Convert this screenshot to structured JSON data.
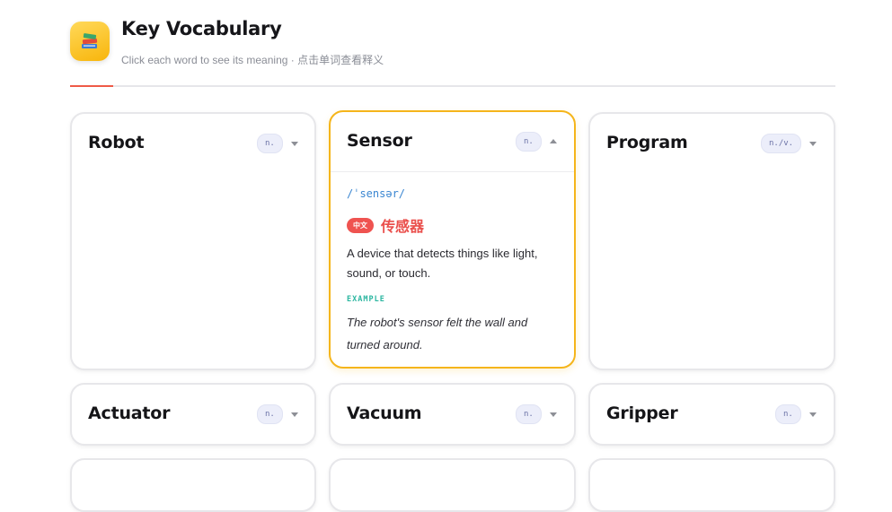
{
  "header": {
    "title": "Key Vocabulary",
    "subtitle": "Click each word to see its meaning · 点击单词查看释义",
    "logo_icon": "books-icon"
  },
  "colors": {
    "accent_line": "#ef5a47",
    "open_card_border": "#f5b51b",
    "chinese_badge": "#ef5350",
    "example_label": "#2bb6a0",
    "ipa": "#3a86d1"
  },
  "cards": [
    {
      "word": "Robot",
      "pos": "n.",
      "expanded": false
    },
    {
      "word": "Sensor",
      "pos": "n.",
      "expanded": true,
      "ipa": "/ˈsensər/",
      "cn_badge": "中文",
      "cn_word": "传感器",
      "definition": "A device that detects things like light, sound, or touch.",
      "example_label": "EXAMPLE",
      "example": "The robot's sensor felt the wall and turned around."
    },
    {
      "word": "Program",
      "pos": "n./v.",
      "expanded": false
    },
    {
      "word": "Actuator",
      "pos": "n.",
      "expanded": false
    },
    {
      "word": "Vacuum",
      "pos": "n.",
      "expanded": false
    },
    {
      "word": "Gripper",
      "pos": "n.",
      "expanded": false
    }
  ]
}
